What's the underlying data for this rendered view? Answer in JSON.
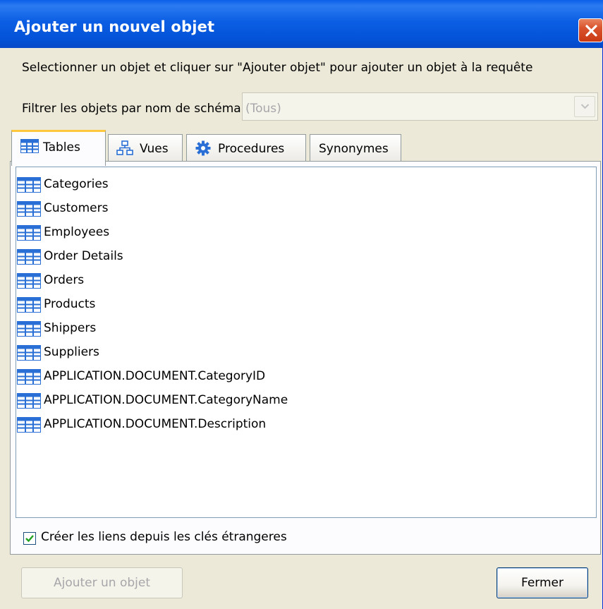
{
  "window": {
    "title": "Ajouter un nouvel objet"
  },
  "description": "Selectionner un objet et cliquer sur \"Ajouter objet\" pour ajouter un objet à la requête",
  "filter": {
    "label": "Filtrer les objets par nom de schéma",
    "value": "(Tous)"
  },
  "tabs": [
    {
      "label": "Tables",
      "icon": "table-icon",
      "active": true
    },
    {
      "label": "Vues",
      "icon": "view-icon",
      "active": false
    },
    {
      "label": "Procedures",
      "icon": "gear-icon",
      "active": false
    },
    {
      "label": "Synonymes",
      "icon": "",
      "active": false
    }
  ],
  "objects": [
    "Categories",
    "Customers",
    "Employees",
    "Order Details",
    "Orders",
    "Products",
    "Shippers",
    "Suppliers",
    "APPLICATION.DOCUMENT.CategoryID",
    "APPLICATION.DOCUMENT.CategoryName",
    "APPLICATION.DOCUMENT.Description"
  ],
  "options": {
    "create_links_label": "Créer les liens depuis les clés étrangeres",
    "create_links_checked": true
  },
  "buttons": {
    "add_label": "Ajouter un objet",
    "close_label": "Fermer"
  },
  "colors": {
    "titlebar": "#0453d8",
    "window_bg": "#ece9d8",
    "close_red": "#d9532c",
    "tab_active_accent": "#ffc83c",
    "table_icon_blue": "#2a6fd6"
  }
}
